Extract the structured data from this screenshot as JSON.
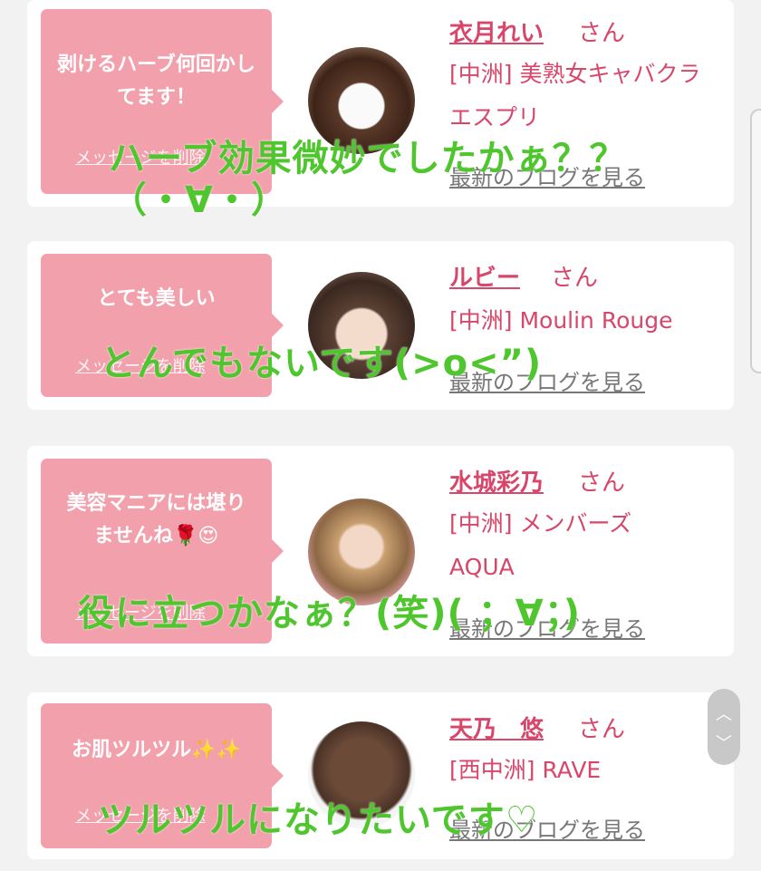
{
  "cards": [
    {
      "message": "剥けるハーブ何回かしてます！",
      "delete_label": "メッセージを削除",
      "name": "衣月れい",
      "san": "さん",
      "shop": "[中洲] 美熟女キャバクラ エスプリ",
      "blog": "最新のブログを見る",
      "overlay": "ハーブ効果微妙でしたかぁ？？",
      "overlay2": "（・∀・）"
    },
    {
      "message": "とても美しい",
      "delete_label": "メッセージを削除",
      "name": "ルビー",
      "san": "さん",
      "shop": "[中洲] Moulin Rouge",
      "blog": "最新のブログを見る",
      "overlay": "とんでもないです(>o<”)"
    },
    {
      "message": "美容マニアには堪りませんね🌹😍",
      "delete_label": "メッセージを削除",
      "name": "水城彩乃",
      "san": "さん",
      "shop": "[中洲] メンバーズ AQUA",
      "blog": "最新のブログを見る",
      "overlay": "役に立つかなぁ？(笑)( ；∀；)"
    },
    {
      "message": "お肌ツルツル✨✨",
      "delete_label": "メッセージを削除",
      "name": "天乃　悠",
      "san": "さん",
      "shop": "[西中洲] RAVE",
      "blog": "最新のブログを見る",
      "overlay": "ツルツルになりたいです♡"
    }
  ],
  "scroll": {
    "up": "︿",
    "down": "﹀"
  },
  "colors": {
    "accent": "#d8466a",
    "bubble": "#f3a0ad",
    "overlay": "#4fc62e"
  }
}
